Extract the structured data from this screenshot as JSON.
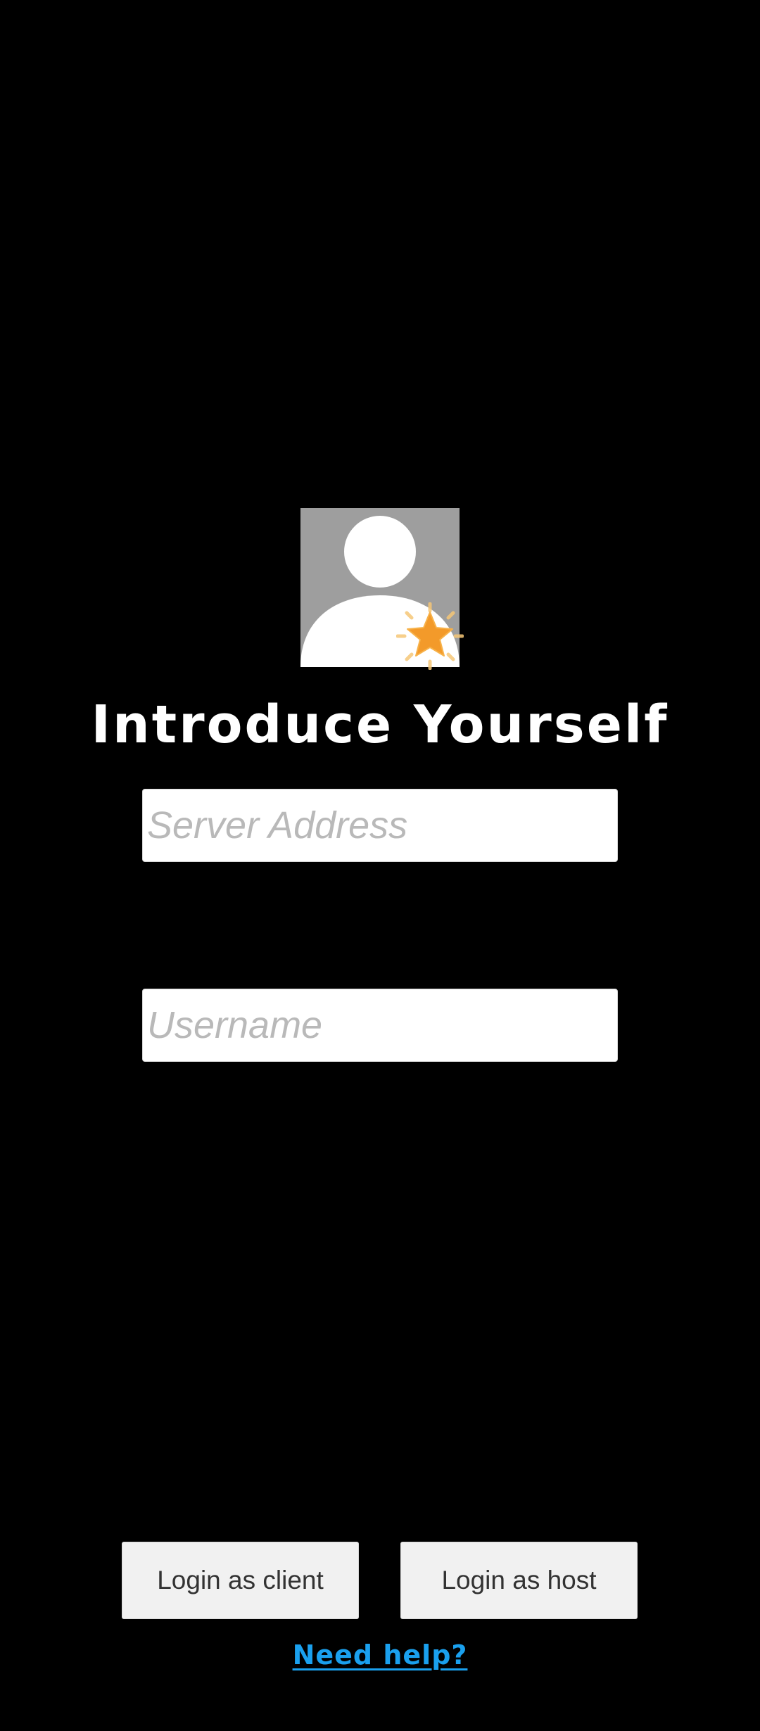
{
  "login": {
    "avatar_icon": "default-user-avatar-icon",
    "badge_icon": "orange-star-badge-icon",
    "title": "Introduce Yourself",
    "server_field": {
      "value": "",
      "placeholder": "Server Address"
    },
    "username_field": {
      "value": "",
      "placeholder": "Username"
    },
    "client_button_label": "Login as client",
    "host_button_label": "Login as host",
    "help_link_label": "Need help?"
  },
  "colors": {
    "background": "#000000",
    "avatar_bg": "#9e9e9e",
    "title": "#ffffff",
    "link": "#1aa0ee",
    "badge": "#f39a2a"
  }
}
